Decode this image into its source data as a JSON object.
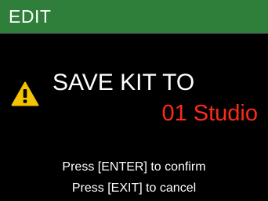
{
  "header": {
    "title": "EDIT"
  },
  "dialog": {
    "icon": "warning-icon",
    "title": "SAVE KIT TO",
    "kit_name": "01 Studio",
    "confirm_text": "Press [ENTER] to confirm",
    "cancel_text": "Press [EXIT] to cancel"
  },
  "colors": {
    "background": "#000000",
    "header_bg": "#2f7f3b",
    "kit_name": "#ff2a1a",
    "warning": "#f5c400"
  }
}
